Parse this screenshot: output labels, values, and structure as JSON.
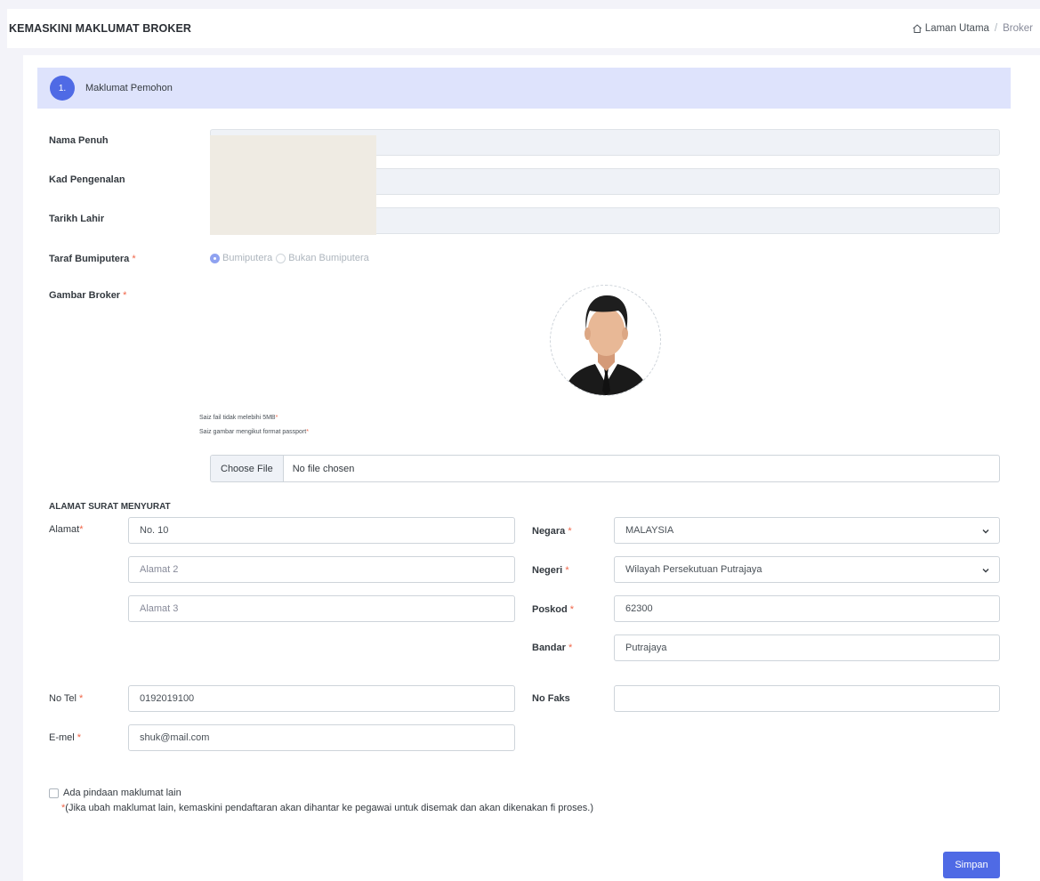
{
  "header": {
    "title": "KEMASKINI MAKLUMAT BROKER",
    "breadcrumb": {
      "home": "Laman Utama",
      "separator": "/",
      "current": "Broker"
    }
  },
  "step": {
    "number": "1.",
    "label": "Maklumat Pemohon"
  },
  "fields": {
    "nama_penuh": {
      "label": "Nama Penuh",
      "value": ""
    },
    "kad_pengenalan": {
      "label": "Kad Pengenalan",
      "value": ""
    },
    "tarikh_lahir": {
      "label": "Tarikh Lahir",
      "value": ""
    },
    "taraf_bumiputera": {
      "label": "Taraf Bumiputera",
      "required": "*",
      "options": [
        "Bumiputera",
        "Bukan Bumiputera"
      ],
      "selected": "Bumiputera"
    },
    "gambar_broker": {
      "label": "Gambar Broker",
      "required": "*",
      "hint1": "Saiz fail tidak melebihi 5MB",
      "hint2": "Saiz gambar mengikut format passport",
      "file_button": "Choose File",
      "file_status": "No file chosen"
    }
  },
  "address": {
    "section_title": "ALAMAT SURAT MENYURAT",
    "alamat_label": "Alamat",
    "alamat1": "No. 10",
    "alamat2_placeholder": "Alamat 2",
    "alamat3_placeholder": "Alamat 3",
    "negara_label": "Negara",
    "negara_value": "MALAYSIA",
    "negeri_label": "Negeri",
    "negeri_value": "Wilayah Persekutuan Putrajaya",
    "poskod_label": "Poskod",
    "poskod_value": "62300",
    "bandar_label": "Bandar",
    "bandar_value": "Putrajaya"
  },
  "contact": {
    "tel_label": "No Tel",
    "tel_value": "0192019100",
    "faks_label": "No Faks",
    "faks_value": "",
    "email_label": "E-mel",
    "email_value": "shuk@mail.com"
  },
  "amend": {
    "checkbox_label": "Ada pindaan maklumat lain",
    "note": "(Jika ubah maklumat lain, kemaskini pendaftaran akan dihantar ke pegawai untuk disemak dan akan dikenakan fi proses.)"
  },
  "actions": {
    "save_label": "Simpan"
  },
  "colors": {
    "primary": "#4f6ae5",
    "step_bg": "#dee3fc",
    "required": "#f06548"
  }
}
